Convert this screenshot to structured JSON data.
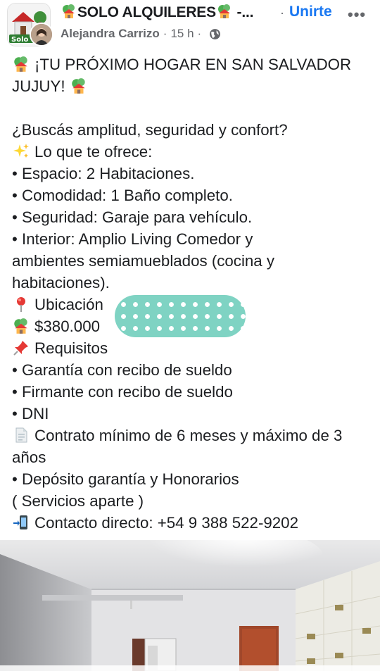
{
  "group": {
    "name": "SOLO ALQUILERES",
    "name_suffix": "-...",
    "join_label": "Unirte",
    "more_label": "•••",
    "avatar_icon": "group-logo-icon"
  },
  "author": {
    "name": "Alejandra Carrizo",
    "time": "15 h",
    "privacy_icon": "globe-icon"
  },
  "post": {
    "headline": "¡TU PRÓXIMO HOGAR EN SAN SALVADOR JUJUY!",
    "question": "¿Buscás amplitud, seguridad y confort?",
    "offer_intro": "Lo que te ofrece:",
    "features": [
      "• Espacio: 2 Habitaciones.",
      "• Comodidad: 1 Baño completo.",
      "• Seguridad: Garaje para vehículo.",
      "• Interior: Amplio Living Comedor y ambientes semiamueblados (cocina y habitaciones)."
    ],
    "location_label": "Ubicación",
    "price": "$380.000",
    "requirements_label": "Requisitos",
    "requirements": [
      "• Garantía con recibo de sueldo",
      "• Firmante con recibo de sueldo",
      "• DNI"
    ],
    "contract": "Contrato mínimo de 6 meses y máximo de 3 años",
    "deposit": "• Depósito garantía y Honorarios",
    "services": "( Servicios aparte )",
    "contact": "Contacto directo: +54 9 388 522-9202",
    "icons": {
      "house": "house-with-tree-icon",
      "sparkles": "sparkles-icon",
      "pin": "round-pushpin-icon",
      "pushpin": "pushpin-icon",
      "document": "page-document-icon",
      "phone": "mobile-phone-arrow-icon"
    }
  },
  "colors": {
    "link_blue": "#1877f2",
    "secondary_text": "#65676b",
    "redaction": "#7fd3c3"
  }
}
